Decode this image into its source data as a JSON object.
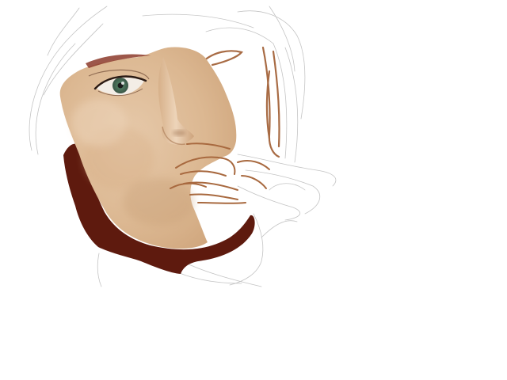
{
  "artwork": {
    "subject": "digital-painting-face-sketch",
    "palette": {
      "background": "#ffffff",
      "skin_light": "#e2c4a4",
      "skin_mid": "#d8b48e",
      "skin_shadow": "#c69d74",
      "hair_dark": "#5e1a0e",
      "lip_sketch": "#a8693f",
      "sketch_line": "#b9b9b9",
      "iris": "#4f7a5f",
      "eyebrow": "#8c3a2a"
    },
    "elements": [
      "face-painted-area",
      "hair-dark-stroke",
      "eye-painted",
      "nose-painted",
      "lips-sketch",
      "ear-sketch",
      "outline-sketch-lines"
    ]
  }
}
